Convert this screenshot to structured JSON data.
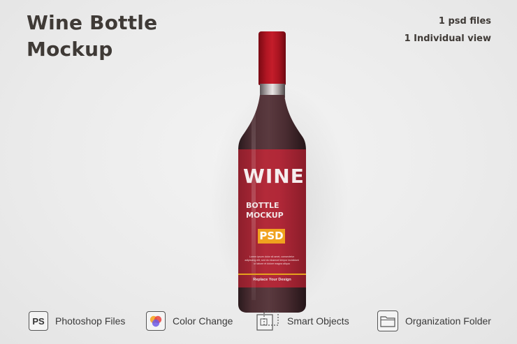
{
  "heading": {
    "line1": "Wine Bottle",
    "line2": "Mockup"
  },
  "meta": {
    "files": "1 psd files",
    "views": "1 Individual view"
  },
  "bottle": {
    "label_title": "WINE",
    "label_sub1": "BOTTLE",
    "label_sub2": "MOCKUP",
    "badge": "PSD",
    "small_text": "Lorem ipsum dolor sit amet, consectetur adipiscing elit, sed do eiusmod tempor incididunt ut labore et dolore magna aliqua",
    "footer": "Replace Your Design",
    "colors": {
      "cap": "#b21623",
      "label": "#b32a39",
      "badge": "#f0a21f",
      "glass": "#4e2f34"
    }
  },
  "features": [
    {
      "label": "Photoshop Files",
      "icon": "ps-icon",
      "icon_text": "PS"
    },
    {
      "label": "Color Change",
      "icon": "color-change-icon"
    },
    {
      "label": "Smart Objects",
      "icon": "smart-objects-icon"
    },
    {
      "label": "Organization Folder",
      "icon": "folder-icon"
    }
  ]
}
